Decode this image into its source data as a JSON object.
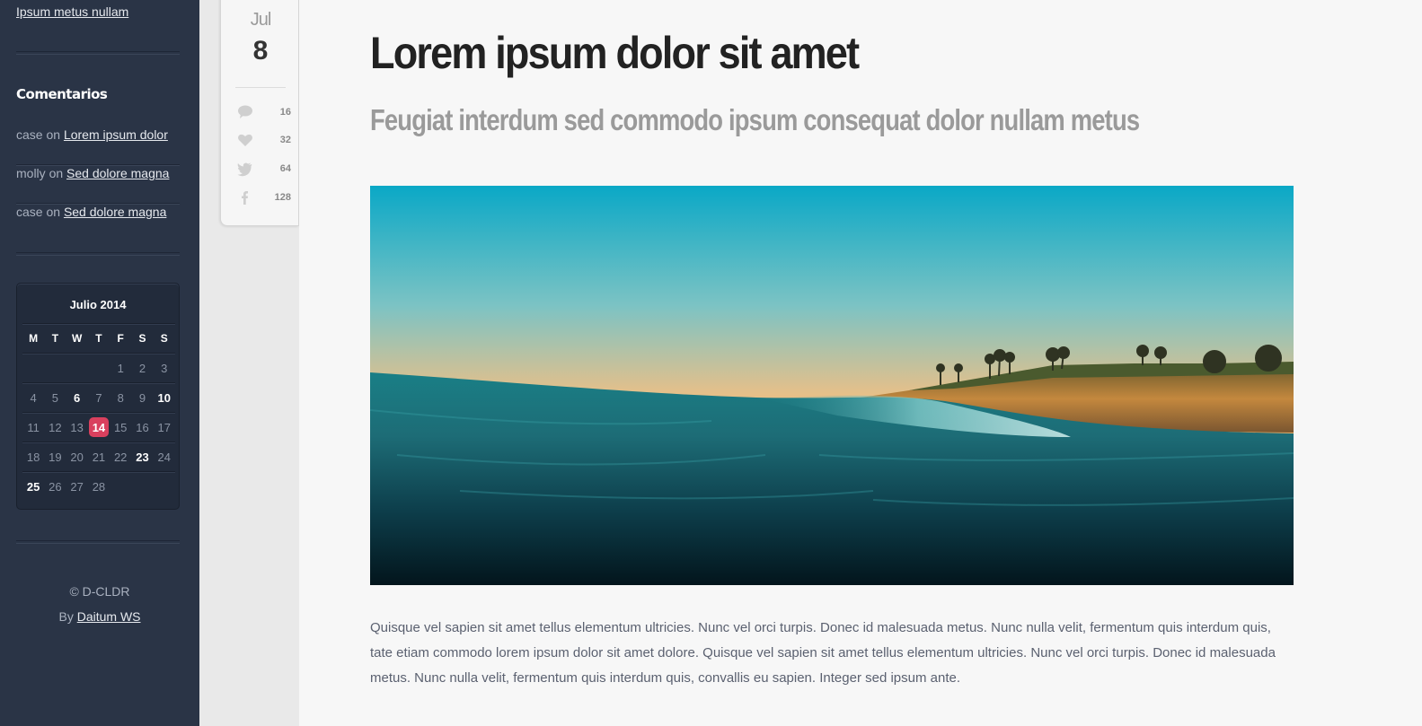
{
  "sidebar": {
    "top_link": "Ipsum metus nullam",
    "comments_heading": "Comentarios",
    "comments": [
      {
        "author": "case",
        "sep": "on",
        "link": "Lorem ipsum dolor"
      },
      {
        "author": "molly",
        "sep": "on",
        "link": "Sed dolore magna"
      },
      {
        "author": "case",
        "sep": "on",
        "link": "Sed dolore magna"
      }
    ],
    "calendar": {
      "title": "Julio 2014",
      "weekdays": [
        "M",
        "T",
        "W",
        "T",
        "F",
        "S",
        "S"
      ],
      "weeks": [
        [
          "",
          "",
          "",
          "",
          "1",
          "2",
          "3"
        ],
        [
          "4",
          "5",
          "6",
          "7",
          "8",
          "9",
          "10"
        ],
        [
          "11",
          "12",
          "13",
          "14",
          "15",
          "16",
          "17"
        ],
        [
          "18",
          "19",
          "20",
          "21",
          "22",
          "23",
          "24"
        ],
        [
          "25",
          "26",
          "27",
          "28",
          "",
          "",
          ""
        ]
      ],
      "bold_days": [
        "6",
        "10",
        "23",
        "25"
      ],
      "today": "14"
    },
    "footer_copy": "© D-CLDR",
    "footer_by": "By",
    "footer_link": "Daitum WS"
  },
  "meta": {
    "month": "Jul",
    "day": "8",
    "stats": [
      {
        "icon": "comment-icon",
        "count": "16"
      },
      {
        "icon": "heart-icon",
        "count": "32"
      },
      {
        "icon": "twitter-icon",
        "count": "64"
      },
      {
        "icon": "facebook-icon",
        "count": "128"
      }
    ]
  },
  "post": {
    "title": "Lorem ipsum dolor sit amet",
    "subtitle": "Feugiat interdum sed commodo ipsum consequat dolor nullam metus",
    "body": "Quisque vel sapien sit amet tellus elementum ultricies. Nunc vel orci turpis. Donec id malesuada metus. Nunc nulla velit, fermentum quis interdum quis, tate etiam commodo lorem ipsum dolor sit amet dolore. Quisque vel sapien sit amet tellus elementum ultricies. Nunc vel orci turpis. Donec id malesuada metus. Nunc nulla velit, fermentum quis interdum quis, convallis eu sapien. Integer sed ipsum ante."
  },
  "colors": {
    "sidebar_bg": "#2a3446",
    "today_badge": "#d9405e",
    "main_bg": "#f7f7f7"
  }
}
